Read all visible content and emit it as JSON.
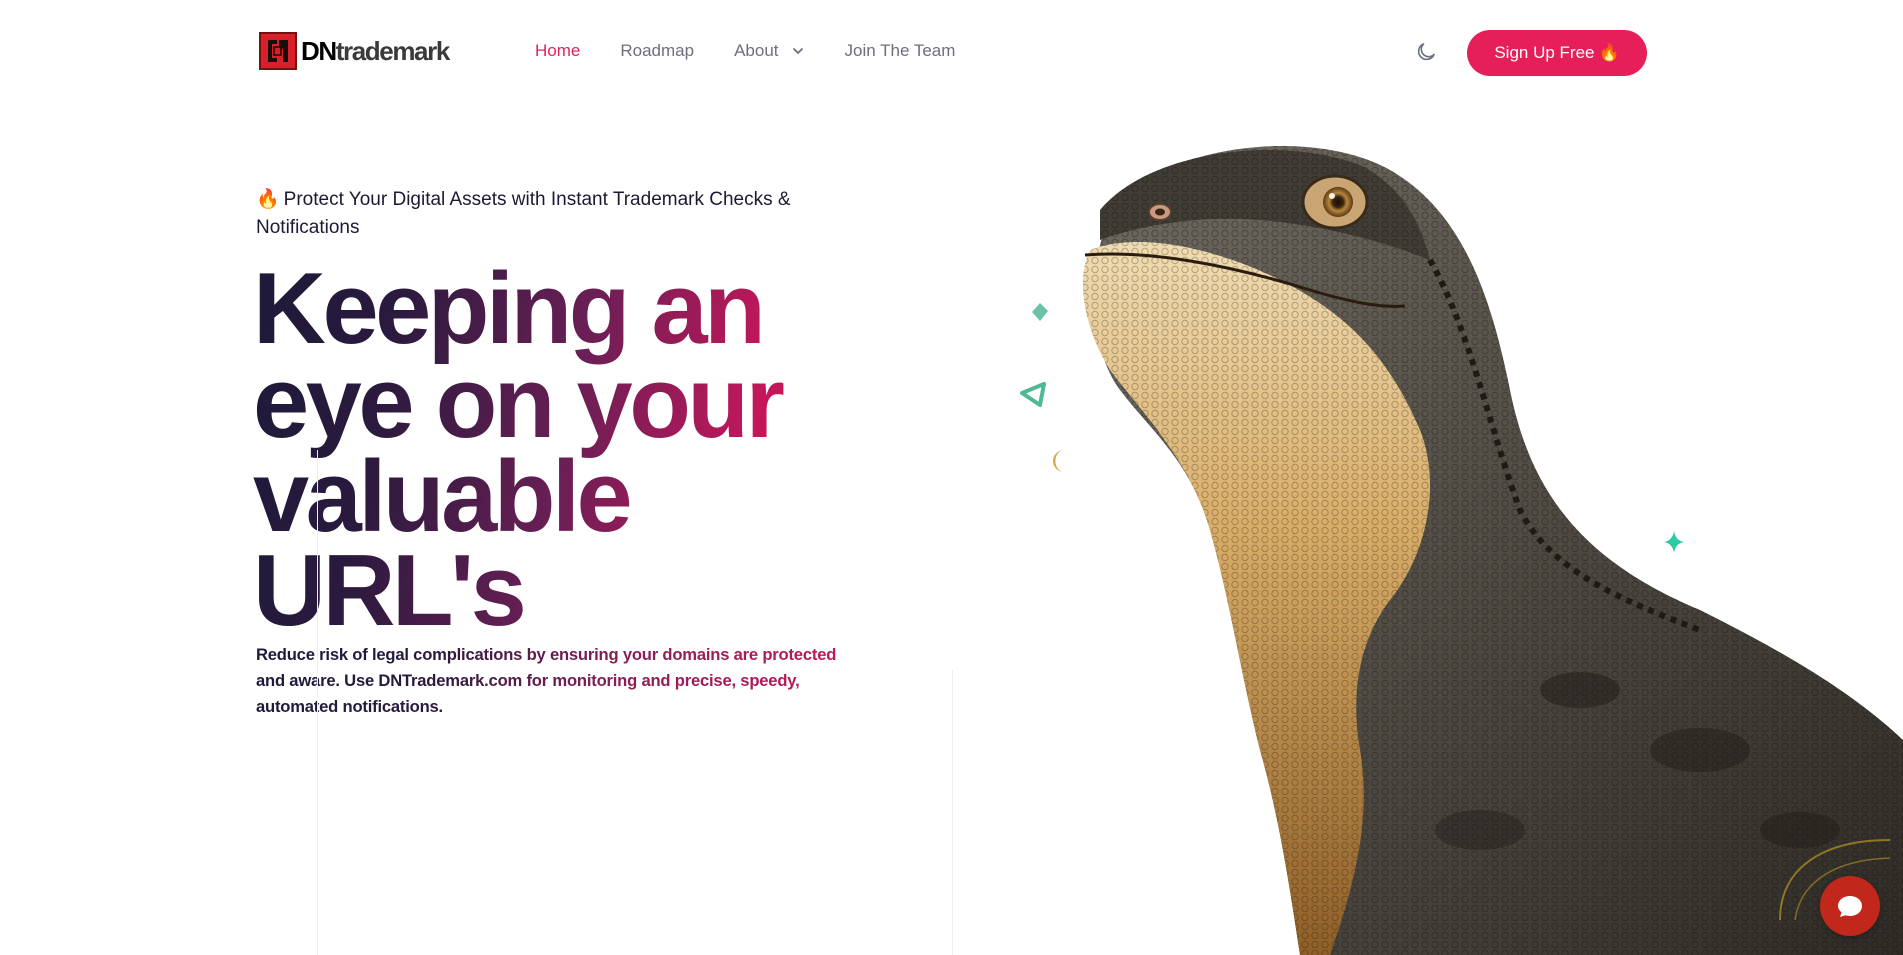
{
  "header": {
    "logo": {
      "text_strong": "DN",
      "text_rest": "trademark"
    },
    "nav": [
      {
        "label": "Home",
        "active": true
      },
      {
        "label": "Roadmap",
        "active": false
      },
      {
        "label": "About",
        "active": false,
        "has_dropdown": true
      },
      {
        "label": "Join The Team",
        "active": false
      }
    ],
    "theme_toggle_icon": "moon-icon",
    "signup": {
      "label": "Sign Up Free",
      "emoji": "🔥"
    }
  },
  "hero": {
    "tagline_emoji": "🔥",
    "tagline": "Protect Your Digital Assets with Instant Trademark Checks & Notifications",
    "headline": "Keeping an eye on your valuable URL's",
    "subtext": "Reduce risk of legal complications by ensuring your domains are protected and aware. Use DNTrademark.com for monitoring and precise, speedy, automated notifications."
  },
  "colors": {
    "accent": "#e61e5a",
    "active_nav": "#e0225d",
    "nav_text": "#6b6f80",
    "heading_dark": "#1e1a3a",
    "heading_pink": "#c4175a",
    "chat_button": "#c1271a"
  },
  "icons": {
    "chat": "chat-bubble-icon",
    "dropdown": "chevron-down-icon",
    "decorations": [
      "diamond-shape",
      "triangle-shape",
      "crescent-shape",
      "blue-sparkle",
      "teal-sparkle"
    ]
  }
}
